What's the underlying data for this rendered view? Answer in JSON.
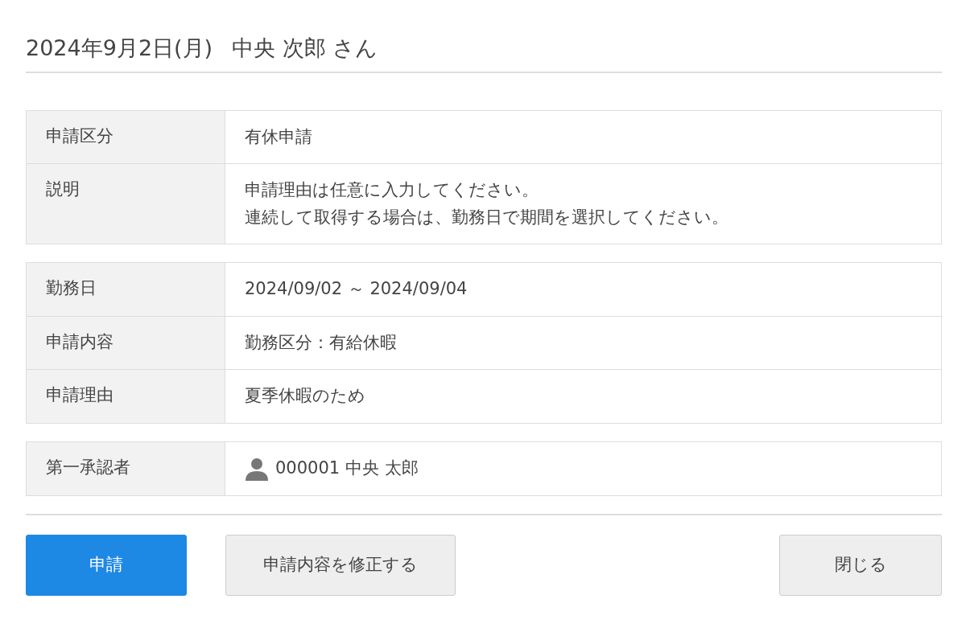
{
  "header": {
    "date": "2024年9月2日(月)",
    "name": "中央 次郎 さん"
  },
  "sections": [
    {
      "rows": [
        {
          "kind": "text",
          "label": "申請区分",
          "lines": [
            "有休申請"
          ]
        },
        {
          "kind": "text",
          "label": "説明",
          "lines": [
            "申請理由は任意に入力してください。",
            "連続して取得する場合は、勤務日で期間を選択してください。"
          ]
        }
      ]
    },
    {
      "rows": [
        {
          "kind": "text",
          "label": "勤務日",
          "lines": [
            "2024/09/02 ～ 2024/09/04"
          ]
        },
        {
          "kind": "text",
          "label": "申請内容",
          "lines": [
            "勤務区分：有給休暇"
          ]
        },
        {
          "kind": "text",
          "label": "申請理由",
          "lines": [
            "夏季休暇のため"
          ]
        }
      ]
    },
    {
      "rows": [
        {
          "kind": "person",
          "label": "第一承認者",
          "lines": [
            "000001 中央 太郎"
          ]
        }
      ]
    }
  ],
  "buttons": {
    "left": [
      {
        "label": "申請",
        "kind": "primary"
      },
      {
        "label": "申請内容を修正する",
        "kind": "secondary"
      }
    ],
    "right": [
      {
        "label": "閉じる",
        "kind": "secondary"
      }
    ]
  }
}
